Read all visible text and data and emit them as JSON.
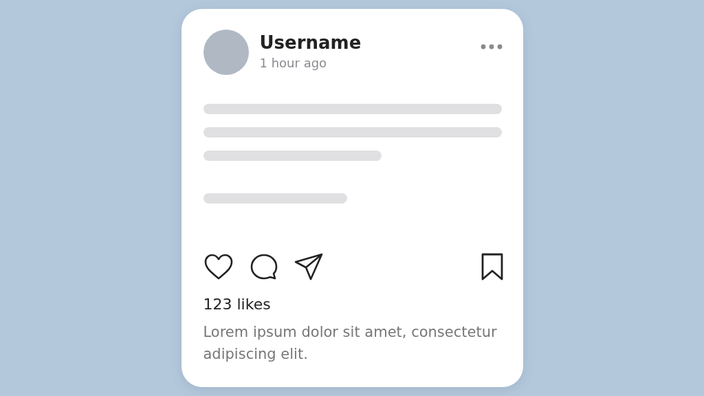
{
  "post": {
    "username": "Username",
    "time": "1 hour ago",
    "likes": "123 likes",
    "caption": "Lorem ipsum dolor sit amet, consectetur adipiscing elit."
  }
}
